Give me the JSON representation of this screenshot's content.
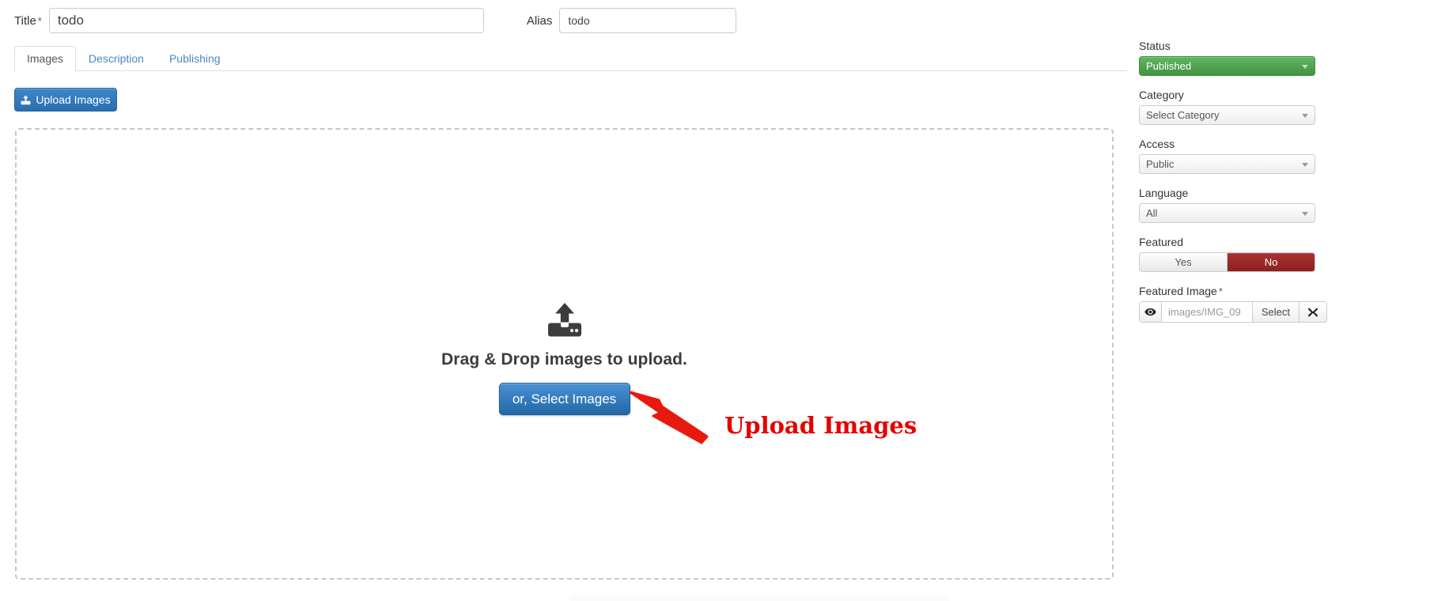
{
  "form": {
    "title_label": "Title",
    "title_required": "*",
    "title_value": "todo",
    "alias_label": "Alias",
    "alias_value": "todo"
  },
  "tabs": [
    {
      "label": "Images",
      "active": true
    },
    {
      "label": "Description",
      "active": false
    },
    {
      "label": "Publishing",
      "active": false
    }
  ],
  "toolbar": {
    "upload_label": "Upload Images",
    "upload_icon": "upload-icon"
  },
  "dropzone": {
    "icon": "inbox-upload-icon",
    "message": "Drag & Drop images to upload.",
    "select_button": "or, Select Images"
  },
  "annotation": {
    "text": "Upload Images",
    "color": "#e60000",
    "arrow": "red-arrow-icon"
  },
  "sidebar": {
    "status": {
      "label": "Status",
      "value": "Published",
      "color": "#4fa34f",
      "caret": "chevron-down-icon"
    },
    "category": {
      "label": "Category",
      "value": "Select Category",
      "caret": "chevron-down-icon"
    },
    "access": {
      "label": "Access",
      "value": "Public",
      "caret": "chevron-down-icon"
    },
    "language": {
      "label": "Language",
      "value": "All",
      "caret": "chevron-down-icon"
    },
    "featured": {
      "label": "Featured",
      "yes_label": "Yes",
      "no_label": "No",
      "selected": "No",
      "selected_color": "#9b2727"
    },
    "featured_image": {
      "label": "Featured Image",
      "required": "*",
      "eye_icon": "eye-icon",
      "value": "images/IMG_09",
      "select_label": "Select",
      "clear_icon": "close-x-icon"
    }
  }
}
